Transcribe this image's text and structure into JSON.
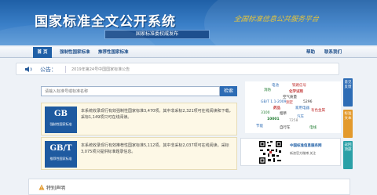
{
  "banner": {
    "title": "国家标准全文公开系统",
    "subtitle": "国家标准委权威发布",
    "slogan": "全国标准信息公共服务平台"
  },
  "nav": {
    "items": [
      "首 页",
      "强制性国家标准",
      "推荐性国家标准"
    ],
    "right_items": [
      "帮助",
      "联系我们"
    ]
  },
  "notice": {
    "label": "公告：",
    "text": "2019年第24号中国国家标准公告"
  },
  "search": {
    "placeholder": "请输入标准号或标准名称",
    "button": "检索"
  },
  "standards": [
    {
      "code": "GB",
      "name": "强制性国家标准",
      "desc": "本系统收录现行有效强制性国家标准3,470项。其中非采标2,321项可在线阅读和下载，采标1,149项只可在线阅读。"
    },
    {
      "code": "GB/T",
      "name": "推荐性国家标准",
      "desc": "本系统收录现行有效推荐性国家标准5,112项。其中非采标2,037项可在线阅读。采标3,075项只提供标准题录信息。"
    }
  ],
  "tag_cloud": [
    "电池",
    "铁路信号",
    "消防",
    "化学试剂",
    "空气质量",
    "GB/T 1.1-2009",
    "测定",
    "5296",
    "药品",
    "家用电器",
    "3100",
    "烟草",
    "汽车",
    "10001",
    "7258",
    "有色金属",
    "节能",
    "自行车",
    "电线"
  ],
  "qr": {
    "caption": "中国标准信息服务网",
    "sub": "新浪官方微博 关注"
  },
  "side_tabs": [
    "意见反馈",
    "标准文本",
    "返回顶部"
  ],
  "disclaimer": {
    "title": "特别声明"
  },
  "colors": {
    "primary": "#1f5fa6",
    "accent_gold": "#e8c63a",
    "side_blue": "#2d6cb5",
    "side_orange": "#e39a2c",
    "side_teal": "#2aa0a7"
  }
}
